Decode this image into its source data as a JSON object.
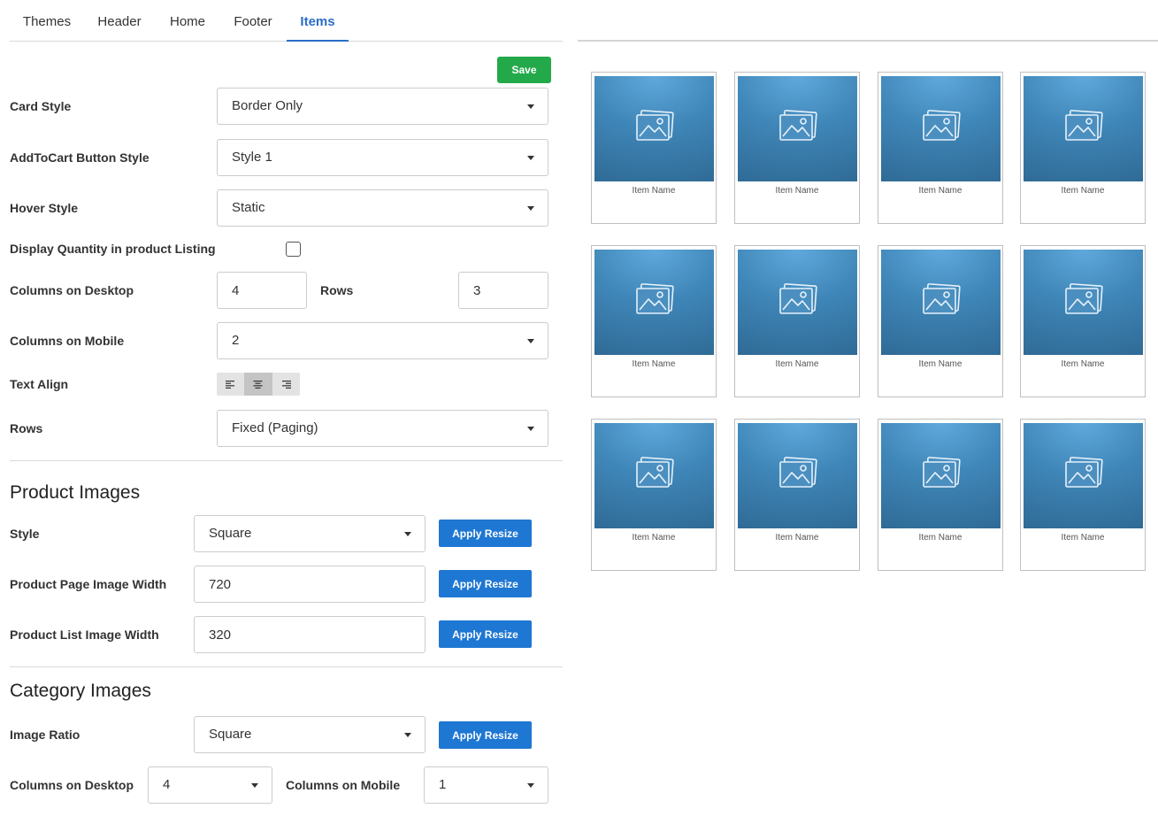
{
  "tabs": [
    {
      "label": "Themes"
    },
    {
      "label": "Header"
    },
    {
      "label": "Home"
    },
    {
      "label": "Footer"
    },
    {
      "label": "Items"
    }
  ],
  "active_tab": "Items",
  "save_label": "Save",
  "settings": {
    "card_style": {
      "label": "Card Style",
      "value": "Border Only"
    },
    "addtocart_style": {
      "label": "AddToCart Button Style",
      "value": "Style 1"
    },
    "hover_style": {
      "label": "Hover Style",
      "value": "Static"
    },
    "display_quantity": {
      "label": "Display Quantity in product Listing",
      "checked": false
    },
    "columns_desktop": {
      "label": "Columns on Desktop",
      "value": "4"
    },
    "rows_count": {
      "label": "Rows",
      "value": "3"
    },
    "columns_mobile": {
      "label": "Columns on Mobile",
      "value": "2"
    },
    "text_align": {
      "label": "Text Align",
      "value": "center"
    },
    "rows_mode": {
      "label": "Rows",
      "value": "Fixed (Paging)"
    }
  },
  "product_images": {
    "title": "Product Images",
    "style": {
      "label": "Style",
      "value": "Square"
    },
    "page_width": {
      "label": "Product Page Image Width",
      "value": "720"
    },
    "list_width": {
      "label": "Product List Image Width",
      "value": "320"
    },
    "apply_label": "Apply Resize"
  },
  "category_images": {
    "title": "Category Images",
    "ratio": {
      "label": "Image Ratio",
      "value": "Square"
    },
    "columns_desktop": {
      "label": "Columns on Desktop",
      "value": "4"
    },
    "columns_mobile": {
      "label": "Columns on Mobile",
      "value": "1"
    },
    "apply_label": "Apply Resize"
  },
  "preview": {
    "items": [
      {
        "name": "Item Name"
      },
      {
        "name": "Item Name"
      },
      {
        "name": "Item Name"
      },
      {
        "name": "Item Name"
      },
      {
        "name": "Item Name"
      },
      {
        "name": "Item Name"
      },
      {
        "name": "Item Name"
      },
      {
        "name": "Item Name"
      },
      {
        "name": "Item Name"
      },
      {
        "name": "Item Name"
      },
      {
        "name": "Item Name"
      },
      {
        "name": "Item Name"
      }
    ],
    "image_icon": "image-placeholder-icon"
  },
  "colors": {
    "accent_blue": "#2a6ec8",
    "save_green": "#23a94a",
    "apply_blue": "#1e77d2"
  }
}
